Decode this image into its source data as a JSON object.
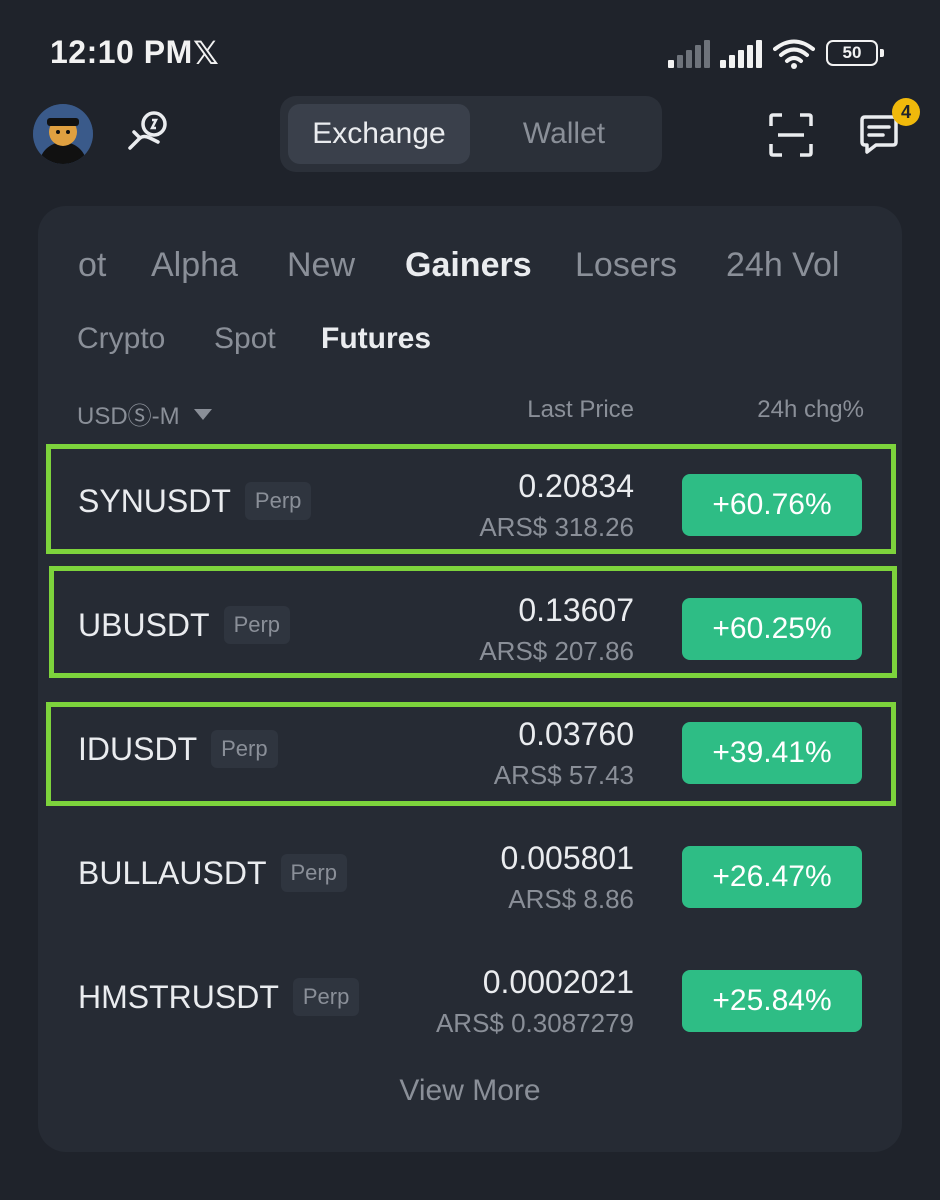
{
  "status_bar": {
    "time": "12:10 PM",
    "x_logo": "𝕏",
    "battery": "50"
  },
  "header": {
    "tabs": [
      {
        "label": "Exchange",
        "active": true
      },
      {
        "label": "Wallet",
        "active": false
      }
    ],
    "notification_count": "4"
  },
  "market": {
    "category_tabs": [
      {
        "label": "ot",
        "active": false
      },
      {
        "label": "Alpha",
        "active": false
      },
      {
        "label": "New",
        "active": false
      },
      {
        "label": "Gainers",
        "active": true
      },
      {
        "label": "Losers",
        "active": false
      },
      {
        "label": "24h Vol",
        "active": false
      }
    ],
    "sub_tabs": [
      {
        "label": "Crypto",
        "active": false
      },
      {
        "label": "Spot",
        "active": false
      },
      {
        "label": "Futures",
        "active": true
      }
    ],
    "columns": {
      "filter": "USDⓈ-M",
      "last_price": "Last Price",
      "change": "24h chg%"
    },
    "rows": [
      {
        "symbol": "SYNUSDT",
        "tag": "Perp",
        "price": "0.20834",
        "fiat": "ARS$ 318.26",
        "change": "+60.76%",
        "highlighted": true
      },
      {
        "symbol": "UBUSDT",
        "tag": "Perp",
        "price": "0.13607",
        "fiat": "ARS$ 207.86",
        "change": "+60.25%",
        "highlighted": true
      },
      {
        "symbol": "IDUSDT",
        "tag": "Perp",
        "price": "0.03760",
        "fiat": "ARS$ 57.43",
        "change": "+39.41%",
        "highlighted": true
      },
      {
        "symbol": "BULLAUSDT",
        "tag": "Perp",
        "price": "0.005801",
        "fiat": "ARS$ 8.86",
        "change": "+26.47%",
        "highlighted": false
      },
      {
        "symbol": "HMSTRUSDT",
        "tag": "Perp",
        "price": "0.0002021",
        "fiat": "ARS$ 0.3087279",
        "change": "+25.84%",
        "highlighted": false
      }
    ],
    "view_more": "View More"
  },
  "colors": {
    "background": "#1f232b",
    "card": "#262b34",
    "positive": "#2ebd85",
    "highlight": "#7dd33c",
    "badge": "#f0b90b"
  }
}
